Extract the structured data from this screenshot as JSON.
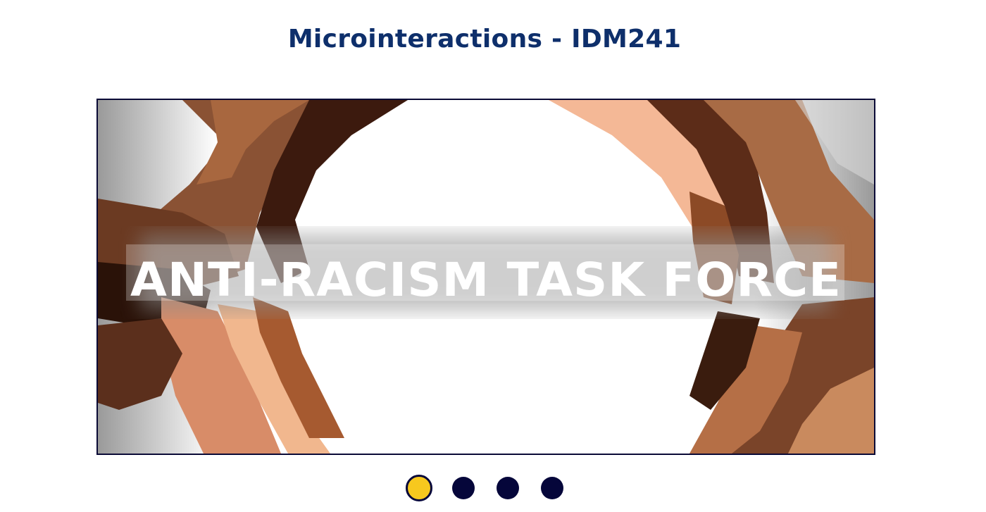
{
  "header": {
    "title": "Microinteractions - IDM241"
  },
  "carousel": {
    "slide_text": "ANTI-RACISM TASK FORCE",
    "slide_count": 4,
    "active_index": 0,
    "active_color": "#f7c81e",
    "dot_color": "#05063a",
    "border_color": "#0a0a36"
  }
}
